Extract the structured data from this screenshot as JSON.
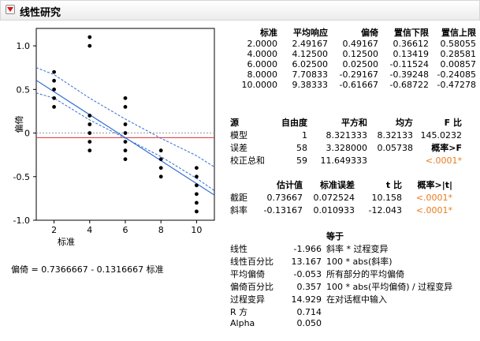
{
  "window": {
    "title": "线性研究"
  },
  "chart_data": {
    "type": "scatter",
    "xlabel": "标准",
    "ylabel": "偏倚",
    "xlim": [
      1,
      11
    ],
    "ylim": [
      -1,
      1.2
    ],
    "x_ticks": [
      2,
      4,
      6,
      8,
      10
    ],
    "y_ticks": [
      1.0,
      0.5,
      0,
      -0.5,
      -1.0
    ],
    "x_tick_labels": [
      "2",
      "4",
      "6",
      "8",
      "10"
    ],
    "y_tick_labels": [
      "1.0",
      "0.5",
      "0",
      "-0.5",
      "-1.0"
    ],
    "points": [
      {
        "x": 2,
        "y": 0.7
      },
      {
        "x": 2,
        "y": 0.6
      },
      {
        "x": 2,
        "y": 0.5
      },
      {
        "x": 2,
        "y": 0.4
      },
      {
        "x": 2,
        "y": 0.3
      },
      {
        "x": 4,
        "y": 1.1
      },
      {
        "x": 4,
        "y": 1.0
      },
      {
        "x": 4,
        "y": 0.2
      },
      {
        "x": 4,
        "y": 0.1
      },
      {
        "x": 4,
        "y": 0.0
      },
      {
        "x": 4,
        "y": -0.1
      },
      {
        "x": 4,
        "y": -0.2
      },
      {
        "x": 6,
        "y": 0.4
      },
      {
        "x": 6,
        "y": 0.3
      },
      {
        "x": 6,
        "y": 0.1
      },
      {
        "x": 6,
        "y": 0.0
      },
      {
        "x": 6,
        "y": -0.1
      },
      {
        "x": 6,
        "y": -0.2
      },
      {
        "x": 6,
        "y": -0.3
      },
      {
        "x": 8,
        "y": -0.2
      },
      {
        "x": 8,
        "y": -0.3
      },
      {
        "x": 8,
        "y": -0.4
      },
      {
        "x": 8,
        "y": -0.5
      },
      {
        "x": 10,
        "y": -0.4
      },
      {
        "x": 10,
        "y": -0.5
      },
      {
        "x": 10,
        "y": -0.6
      },
      {
        "x": 10,
        "y": -0.7
      },
      {
        "x": 10,
        "y": -0.8
      },
      {
        "x": 10,
        "y": -0.9
      }
    ],
    "fit": {
      "intercept": 0.7366667,
      "slope": -0.1316667
    },
    "ci_band": {
      "x": [
        1,
        2,
        4,
        6,
        8,
        10,
        11
      ],
      "lower": [
        0.46,
        0.4,
        0.15,
        -0.06,
        -0.27,
        -0.52,
        -0.66
      ],
      "upper": [
        0.75,
        0.67,
        0.4,
        0.16,
        -0.06,
        -0.26,
        -0.39
      ]
    },
    "bias_mean_line": {
      "y": -0.053
    },
    "zero_line": {
      "y": 0
    },
    "colors": {
      "fit": "#2f6bd3",
      "ci": "#2f6bd3",
      "bias_mean": "#e03131",
      "zero": "#999999",
      "points": "#000000"
    },
    "grid": false
  },
  "equation": "偏倚 = 0.7366667 - 0.1316667 标准",
  "means_table": {
    "headers": [
      "标准",
      "平均响应",
      "偏倚",
      "置信下限",
      "置信上限"
    ],
    "rows": [
      [
        "2.0000",
        "2.49167",
        "0.49167",
        "0.36612",
        "0.58055"
      ],
      [
        "4.0000",
        "4.12500",
        "0.12500",
        "0.13419",
        "0.28581"
      ],
      [
        "6.0000",
        "6.02500",
        "0.02500",
        "-0.11524",
        "0.00857"
      ],
      [
        "8.0000",
        "7.70833",
        "-0.29167",
        "-0.39248",
        "-0.24085"
      ],
      [
        "10.0000",
        "9.38333",
        "-0.61667",
        "-0.68722",
        "-0.47278"
      ]
    ]
  },
  "anova_table": {
    "headers": [
      "源",
      "自由度",
      "平方和",
      "均方",
      "F 比"
    ],
    "rows": [
      [
        "模型",
        "1",
        "8.321333",
        "8.32133",
        "145.0232"
      ],
      [
        "误差",
        "58",
        "3.328000",
        "0.05738",
        ""
      ],
      [
        "校正总和",
        "59",
        "11.649333",
        "",
        ""
      ]
    ],
    "prob_label": "概率>F",
    "prob_value": "<.0001*"
  },
  "estimates_table": {
    "headers": [
      "估计值",
      "标准误差",
      "t 比",
      "概率>|t|"
    ],
    "rows": [
      [
        "截距",
        "0.73667",
        "0.072524",
        "10.158",
        "<.0001*"
      ],
      [
        "斜率",
        "-0.13167",
        "0.010933",
        "-12.043",
        "<.0001*"
      ]
    ]
  },
  "stats_table": {
    "header": "等于",
    "rows": [
      [
        "线性",
        "-1.966",
        "斜率 * 过程变异"
      ],
      [
        "线性百分比",
        "13.167",
        "100 * abs(斜率)"
      ],
      [
        "平均偏倚",
        "-0.053",
        "所有部分的平均偏倚"
      ],
      [
        "偏倚百分比",
        "0.357",
        "100 * abs(平均偏倚) / 过程变异"
      ],
      [
        "过程变异",
        "14.929",
        "在对话框中输入"
      ],
      [
        "R 方",
        "0.714",
        ""
      ],
      [
        "Alpha",
        "0.050",
        ""
      ]
    ]
  }
}
